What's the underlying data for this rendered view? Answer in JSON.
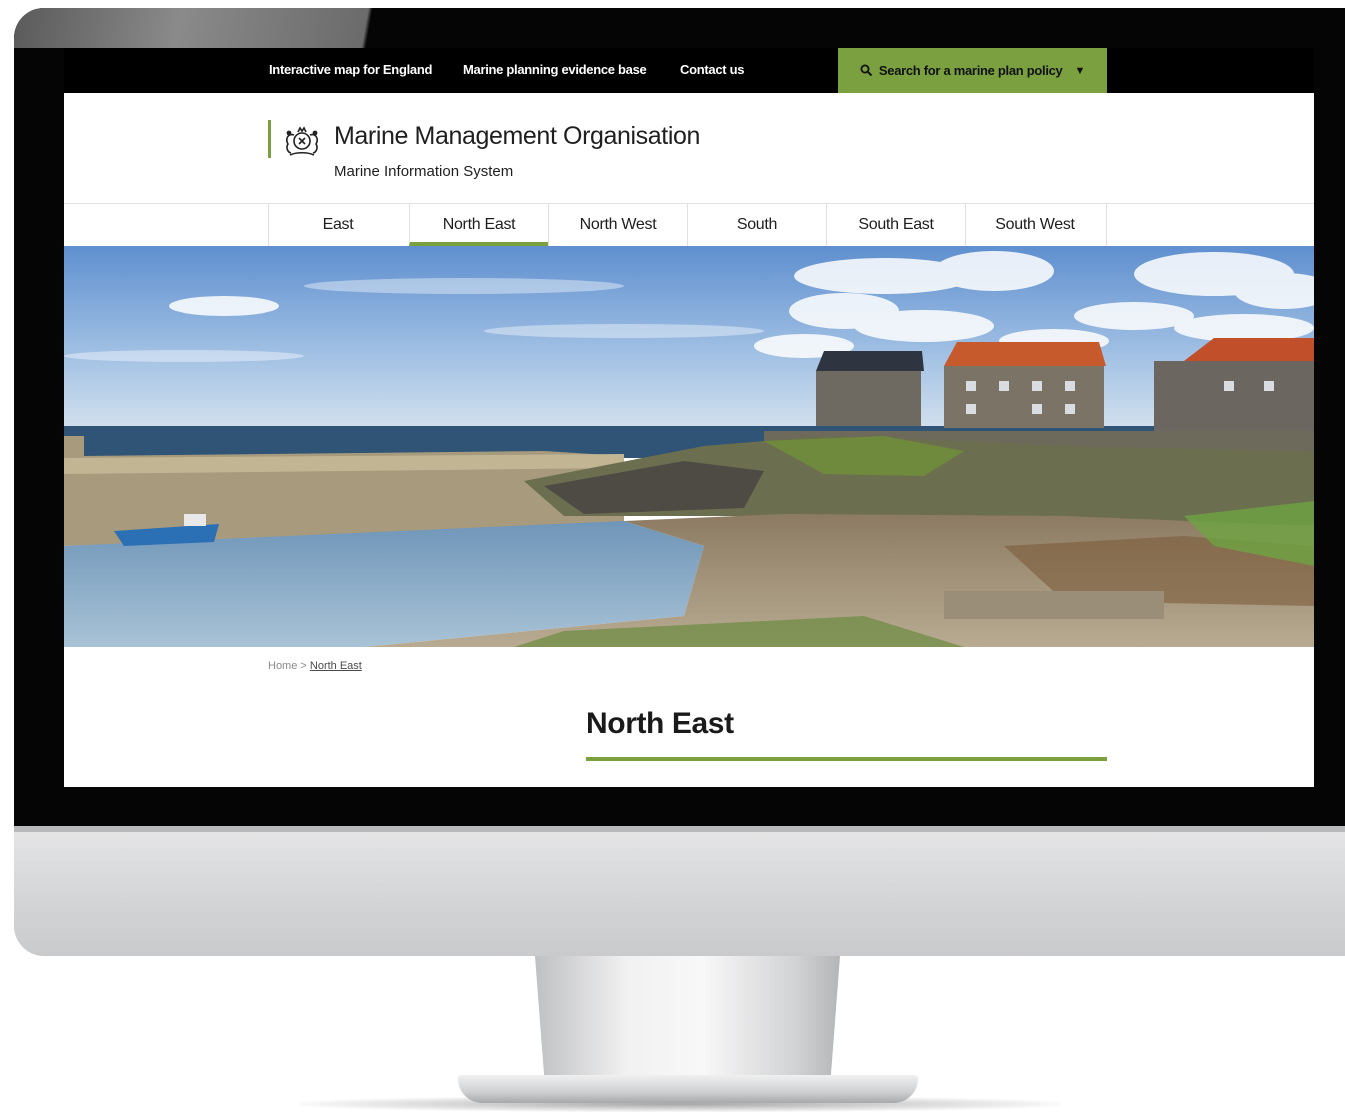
{
  "utility_nav": {
    "links": [
      "Interactive map for England",
      "Marine planning evidence base",
      "Contact us"
    ],
    "search_label": "Search for a marine plan policy"
  },
  "header": {
    "org_name": "Marine Management Organisation",
    "subtitle": "Marine Information System"
  },
  "main_nav": {
    "items": [
      "East",
      "North East",
      "North West",
      "South",
      "South East",
      "South West"
    ],
    "active": "North East"
  },
  "breadcrumb": {
    "home": "Home",
    "separator": ">",
    "current": "North East"
  },
  "page": {
    "title": "North East"
  },
  "colors": {
    "accent": "#7aa03f",
    "utility_bar": "#000000",
    "text": "#1a1a1a"
  },
  "icons": {
    "search": "magnifier-icon",
    "dropdown": "triangle-down-icon",
    "crest": "royal-crest-icon"
  }
}
